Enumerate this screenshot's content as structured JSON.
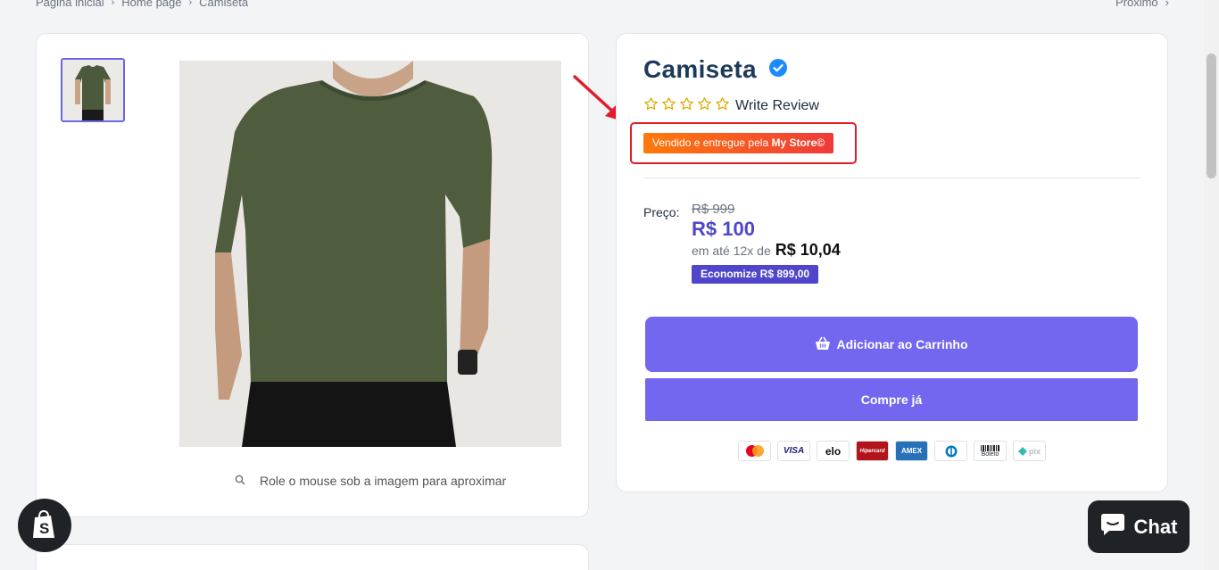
{
  "breadcrumb": {
    "items": [
      "Página inicial",
      "Home page",
      "Camiseta"
    ]
  },
  "nav": {
    "next_label": "Próximo"
  },
  "gallery": {
    "zoom_hint": "Role o mouse sob a imagem para aproximar"
  },
  "product": {
    "title": "Camiseta",
    "rating": {
      "stars": 0,
      "max": 5,
      "review_label": "Write Review"
    },
    "seller": {
      "prefix": "Vendido e entregue pela",
      "store": "My Store©"
    },
    "price": {
      "label": "Preço:",
      "old": "R$ 999",
      "current": "R$ 100",
      "installment_prefix": "em até 12x de",
      "installment_amount": "R$ 10,04",
      "savings": "Economize R$ 899,00"
    },
    "add_to_cart_label": "Adicionar ao Carrinho",
    "buy_now_label": "Compre já"
  },
  "payments": [
    "mastercard-icon",
    "visa-icon",
    "elo-icon",
    "hipercard-icon",
    "amex-icon",
    "diners-icon",
    "boleto-icon",
    "pix-icon"
  ],
  "payment_text": {
    "visa": "VISA",
    "elo": "elo",
    "hipercard": "Hipercard",
    "amex": "AMEX",
    "boleto": "Boleto",
    "pix": "pix"
  },
  "chat": {
    "label": "Chat"
  },
  "colors": {
    "accent": "#7367f0",
    "price": "#4f46c9",
    "seller_badge_start": "#ff7a0a",
    "seller_badge_end": "#ef3a3a",
    "annotation": "#e11d2a"
  }
}
